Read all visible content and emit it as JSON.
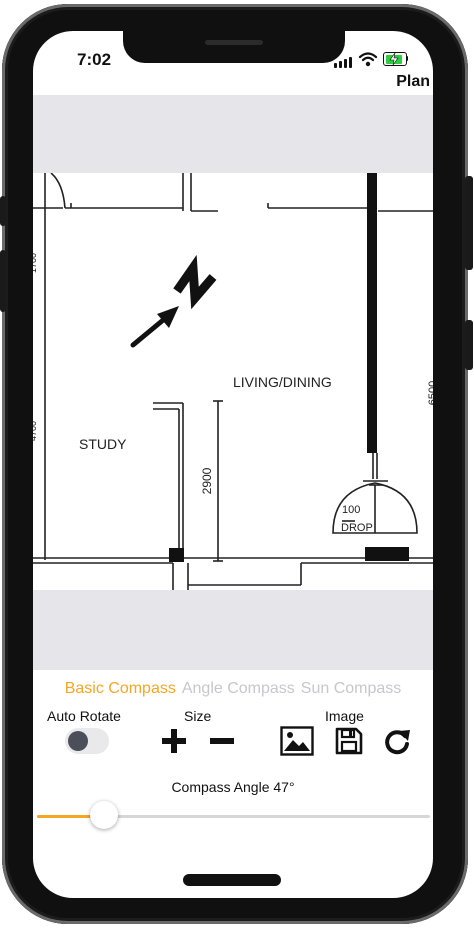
{
  "status_bar": {
    "time": "7:02"
  },
  "nav": {
    "plan_label": "Plan"
  },
  "floorplan": {
    "room_living": "LIVING/DINING",
    "room_study": "STUDY",
    "dim_2900": "2900",
    "dim_1700": "1700",
    "dim_4700": "4700",
    "dim_6500": "6500",
    "drop_100": "100",
    "drop_label": "DROP",
    "compass_letter": "N"
  },
  "tabs": [
    {
      "label": "Basic Compass",
      "active": true
    },
    {
      "label": "Angle Compass",
      "active": false
    },
    {
      "label": "Sun Compass",
      "active": false
    }
  ],
  "controls": {
    "auto_rotate_label": "Auto Rotate",
    "auto_rotate_on": false,
    "size_label": "Size",
    "image_label": "Image"
  },
  "compass_angle": {
    "label": "Compass Angle 47°",
    "value_deg": 47,
    "slider_fraction": 0.17
  },
  "colors": {
    "accent": "#f5a623",
    "inactive_tab": "#c7c7cc",
    "band_gray": "#e5e5ea"
  },
  "icons": [
    "signal-icon",
    "wifi-icon",
    "battery-charging-icon",
    "plus-icon",
    "minus-icon",
    "image-icon",
    "save-icon",
    "rotate-icon"
  ]
}
